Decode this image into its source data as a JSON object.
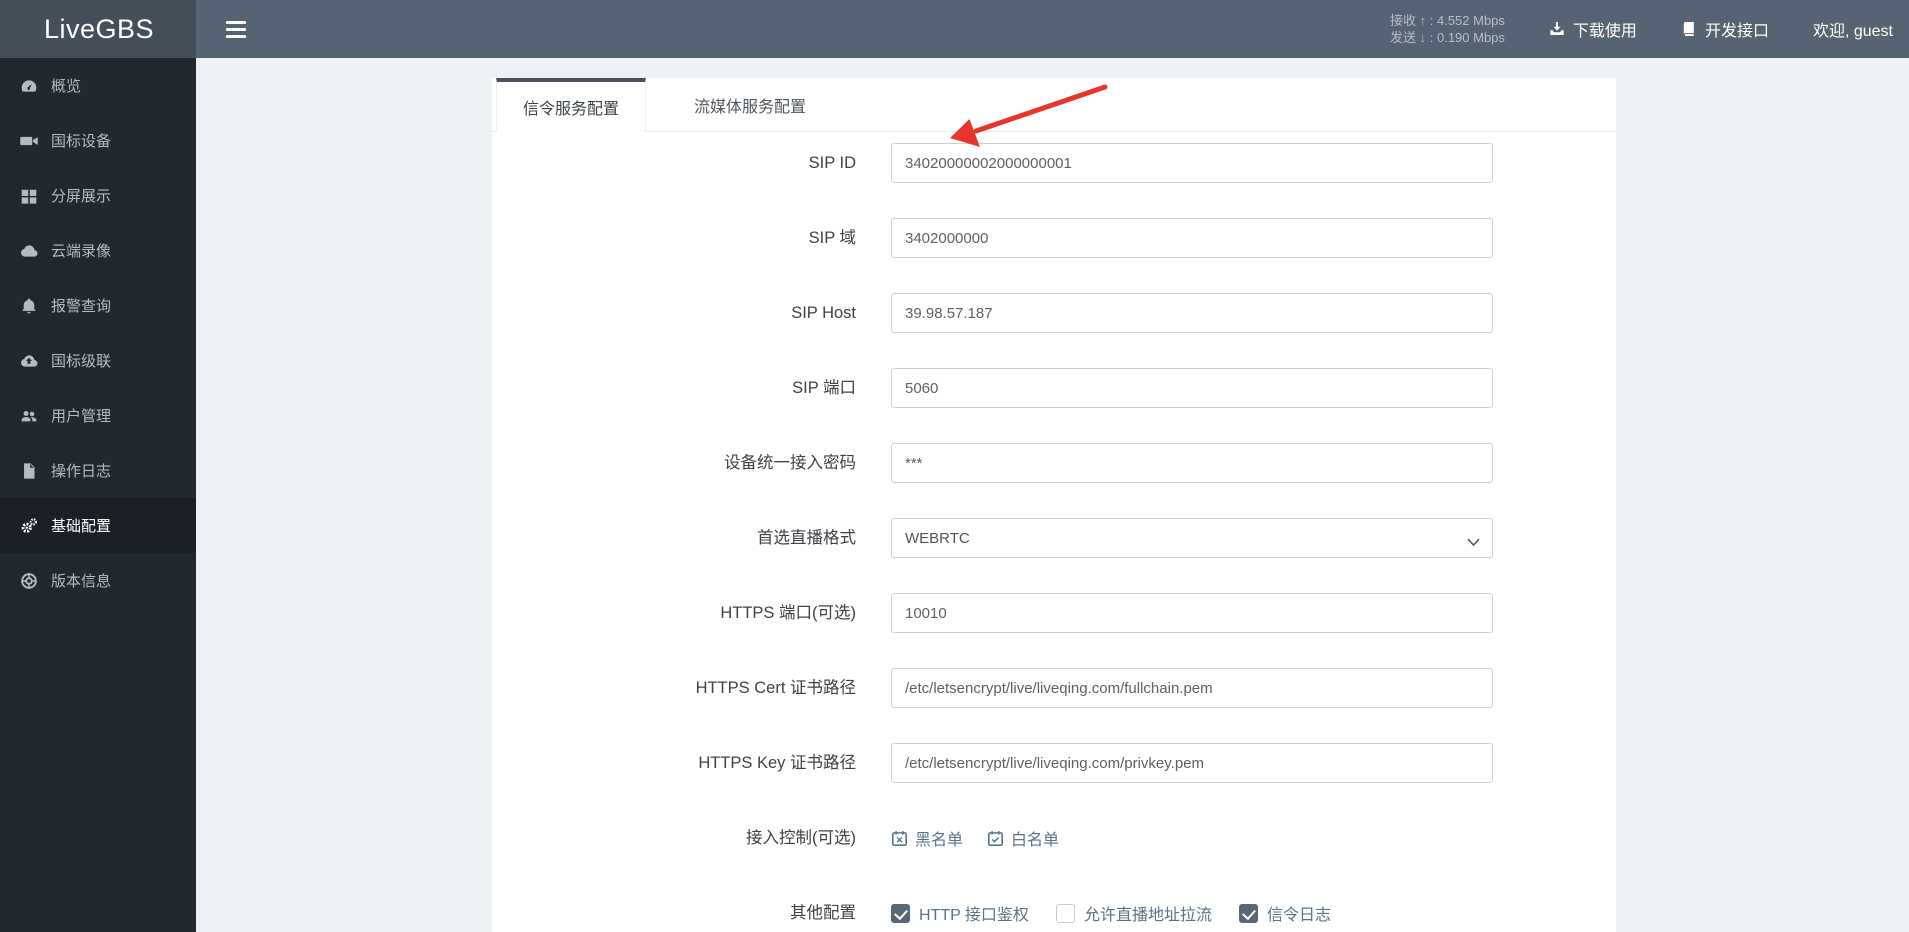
{
  "brand": {
    "logo": "LiveGBS"
  },
  "topbar": {
    "stats": {
      "rx": "接收 ↑ :  4.552 Mbps",
      "tx": "发送 ↓ :  0.190 Mbps"
    },
    "links": [
      {
        "label": "下载使用",
        "icon": "download-icon"
      },
      {
        "label": "开发接口",
        "icon": "book-icon"
      }
    ],
    "welcome": "欢迎, guest"
  },
  "sidebar": {
    "items": [
      {
        "label": "概览",
        "icon": "gauge-icon",
        "active": false
      },
      {
        "label": "国标设备",
        "icon": "video-camera-icon",
        "active": false
      },
      {
        "label": "分屏展示",
        "icon": "grid-icon",
        "active": false
      },
      {
        "label": "云端录像",
        "icon": "cloud-icon",
        "active": false
      },
      {
        "label": "报警查询",
        "icon": "bell-icon",
        "active": false
      },
      {
        "label": "国标级联",
        "icon": "cloud-upload-icon",
        "active": false
      },
      {
        "label": "用户管理",
        "icon": "users-icon",
        "active": false
      },
      {
        "label": "操作日志",
        "icon": "file-icon",
        "active": false
      },
      {
        "label": "基础配置",
        "icon": "cogs-icon",
        "active": true
      },
      {
        "label": "版本信息",
        "icon": "life-ring-icon",
        "active": false
      }
    ]
  },
  "tabs": [
    {
      "label": "信令服务配置",
      "active": true
    },
    {
      "label": "流媒体服务配置",
      "active": false
    }
  ],
  "form": {
    "fields": [
      {
        "label": "SIP ID",
        "type": "input",
        "value": "34020000002000000001"
      },
      {
        "label": "SIP 域",
        "type": "input",
        "value": "3402000000"
      },
      {
        "label": "SIP Host",
        "type": "input",
        "value": "39.98.57.187"
      },
      {
        "label": "SIP 端口",
        "type": "input",
        "value": "5060"
      },
      {
        "label": "设备统一接入密码",
        "type": "input",
        "value": "***"
      },
      {
        "label": "首选直播格式",
        "type": "select",
        "value": "WEBRTC"
      },
      {
        "label": "HTTPS 端口(可选)",
        "type": "input",
        "value": "10010"
      },
      {
        "label": "HTTPS Cert 证书路径",
        "type": "input",
        "value": "/etc/letsencrypt/live/liveqing.com/fullchain.pem"
      },
      {
        "label": "HTTPS Key 证书路径",
        "type": "input",
        "value": "/etc/letsencrypt/live/liveqing.com/privkey.pem"
      },
      {
        "label": "接入控制(可选)",
        "type": "links",
        "items": [
          {
            "label": "黑名单",
            "icon": "calendar-x-icon"
          },
          {
            "label": "白名单",
            "icon": "calendar-check-icon"
          }
        ]
      },
      {
        "label": "其他配置",
        "type": "checkboxes",
        "items": [
          {
            "label": "HTTP 接口鉴权",
            "checked": true
          },
          {
            "label": "允许直播地址拉流",
            "checked": false
          },
          {
            "label": "信令日志",
            "checked": true
          }
        ]
      }
    ]
  },
  "annotation": {
    "shape": "red-arrow",
    "color": "#e8352b",
    "points_at": "SIP ID"
  },
  "colors": {
    "topbar_bg": "#566372",
    "logo_bg": "#454f59",
    "sidebar_bg": "#212830",
    "sidebar_active_bg": "#1a2026",
    "content_bg": "#edf0f4",
    "tab_accent": "#47525d",
    "link_slate": "#5b7384",
    "checkbox_fill": "#576775",
    "arrow_red": "#e8352b"
  }
}
